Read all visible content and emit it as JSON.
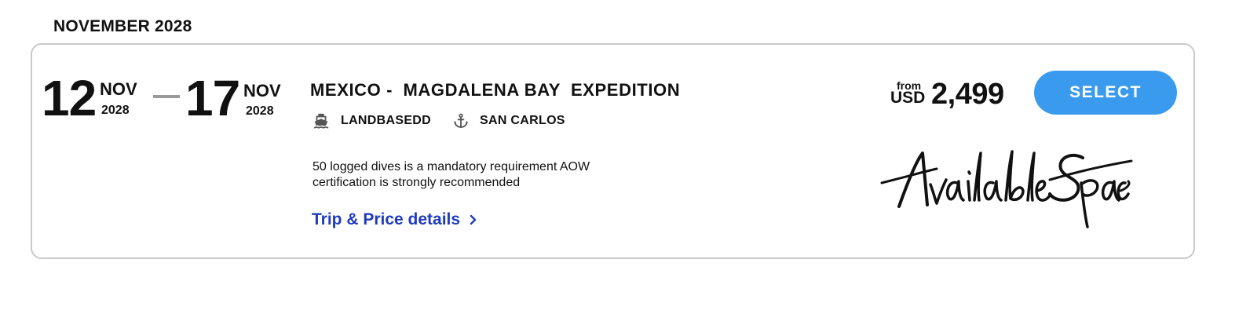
{
  "month_heading": "NOVEMBER 2028",
  "trip": {
    "start": {
      "day": "12",
      "month": "NOV",
      "year": "2028"
    },
    "end": {
      "day": "17",
      "month": "NOV",
      "year": "2028"
    },
    "title": "MEXICO -  MAGDALENA BAY  EXPEDITION",
    "vessel": {
      "icon": "ship-icon",
      "label": "LANDBASEDD"
    },
    "port": {
      "icon": "anchor-icon",
      "label": "SAN CARLOS"
    },
    "description_line1": "50 logged dives is a mandatory requirement AOW",
    "description_line2": "certification is strongly recommended",
    "details_link": "Trip & Price details",
    "price": {
      "from": "from",
      "currency": "USD",
      "amount": "2,499"
    },
    "select_label": "SELECT",
    "availability": "Available Space"
  },
  "colors": {
    "accent": "#3a9bee",
    "link": "#1f3bbf",
    "border": "#c9c9c9",
    "dash": "#9a9a9a"
  }
}
